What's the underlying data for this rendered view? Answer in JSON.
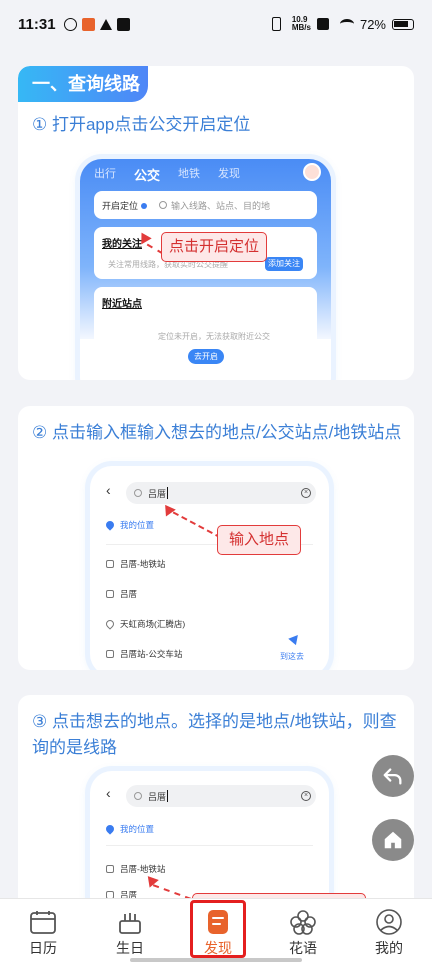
{
  "status_bar": {
    "time": "11:31",
    "net_speed_top": "10.9",
    "net_speed_unit": "MB/s",
    "battery": "72%"
  },
  "section": {
    "title": "一、查询线路"
  },
  "step1": {
    "text": "① 打开app点击公交开启定位",
    "tabs": [
      "出行",
      "公交",
      "地铁",
      "发现"
    ],
    "locate_label": "开启定位",
    "search_placeholder": "输入线路、站点、目的地",
    "my_follow_title": "我的关注",
    "my_follow_desc": "关注常用线路，获取实时公交提醒",
    "add_follow_btn": "添加关注",
    "nearby_title": "附近站点",
    "nearby_desc": "定位未开启，无法获取附近公交",
    "open_btn": "去开启",
    "callout": "点击开启定位"
  },
  "step2": {
    "text": "② 点击输入框输入想去的地点/公交站点/地铁站点",
    "query": "吕厝",
    "my_location": "我的位置",
    "results": [
      "吕厝-地铁站",
      "吕厝",
      "天虹商场(汇腾店)",
      "吕厝站-公交车站"
    ],
    "go_here": "到这去",
    "callout": "输入地点"
  },
  "step3": {
    "text": "③ 点击想去的地点。选择的是地点/地铁站，则查询的是线路",
    "query": "吕厝",
    "my_location": "我的位置",
    "results": [
      "吕厝-地铁站",
      "吕厝"
    ]
  },
  "tabbar": {
    "items": [
      {
        "label": "日历"
      },
      {
        "label": "生日"
      },
      {
        "label": "发现"
      },
      {
        "label": "花语"
      },
      {
        "label": "我的"
      }
    ],
    "active": "发现"
  },
  "colors": {
    "accent": "#3b7fd6",
    "active_tab": "#e8632c",
    "highlight": "#e41f1f"
  }
}
